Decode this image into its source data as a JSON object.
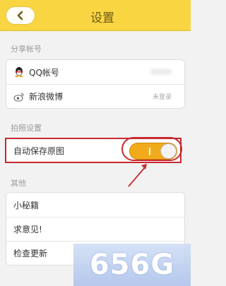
{
  "header": {
    "title": "设置"
  },
  "sections": {
    "share_label": "分享帐号",
    "camera_label": "拍照设置",
    "other_label": "其他"
  },
  "share_items": [
    {
      "label": "QQ帐号",
      "icon": "qq-icon"
    },
    {
      "label": "新浪微博",
      "icon": "weibo-icon",
      "status": "未登录"
    }
  ],
  "camera": {
    "auto_save_label": "自动保存原图",
    "auto_save_on": true
  },
  "other_items": [
    {
      "label": "小秘籍"
    },
    {
      "label": "求意见!"
    },
    {
      "label": "检查更新"
    }
  ],
  "watermark": "656G",
  "colors": {
    "header": "#f9d641",
    "toggle_on": "#f1aa19",
    "annotation": "#c8282e"
  }
}
